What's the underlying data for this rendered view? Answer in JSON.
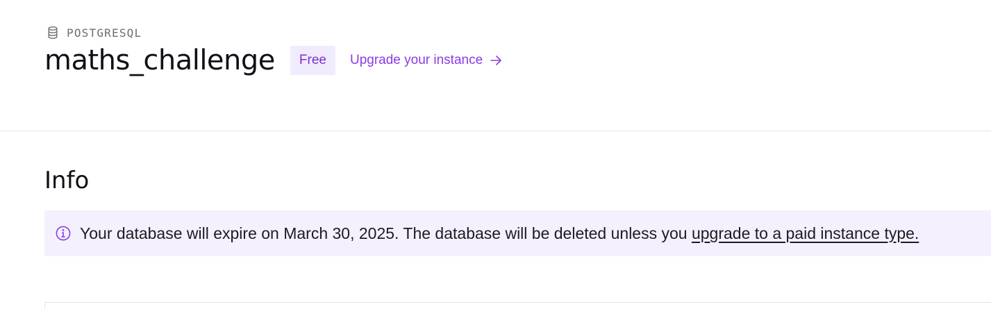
{
  "header": {
    "service_type": "POSTGRESQL",
    "service_icon": "database-icon",
    "title": "maths_challenge",
    "plan_badge": "Free",
    "upgrade_link": "Upgrade your instance",
    "upgrade_icon": "arrow-right-icon"
  },
  "info": {
    "heading": "Info",
    "notice_icon": "info-icon",
    "notice_text": "Your database will expire on March 30, 2025. The database will be deleted unless you ",
    "notice_link": "upgrade to a paid instance type."
  },
  "colors": {
    "accent": "#8a3be6",
    "badge_bg": "#f1ecfd",
    "notice_bg": "#f4f0fd",
    "divider": "#e4e3e8"
  }
}
